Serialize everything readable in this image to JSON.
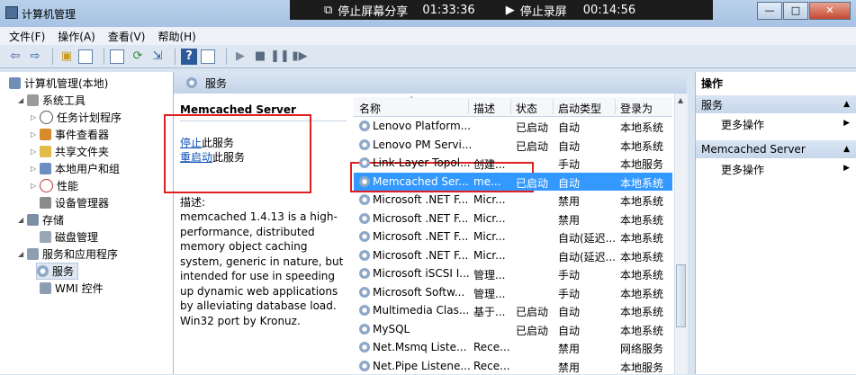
{
  "window": {
    "title": "计算机管理",
    "minimize": "—",
    "maximize": "□",
    "close": "✕"
  },
  "recording": {
    "share_label": "停止屏幕分享",
    "share_time": "01:33:36",
    "record_label": "停止录屏",
    "record_time": "00:14:56"
  },
  "menu": [
    "文件(F)",
    "操作(A)",
    "查看(V)",
    "帮助(H)"
  ],
  "toolbar_icons": [
    "back-icon",
    "forward-icon",
    "up-icon",
    "console-tree-icon",
    "properties-icon",
    "refresh-icon",
    "export-icon",
    "help-icon",
    "show-hide-icon",
    "play-icon",
    "stop-icon",
    "pause-icon",
    "restart-icon"
  ],
  "tree": {
    "root": "计算机管理(本地)",
    "system_tools": "系统工具",
    "task_scheduler": "任务计划程序",
    "event_viewer": "事件查看器",
    "shared_folders": "共享文件夹",
    "local_users": "本地用户和组",
    "performance": "性能",
    "device_manager": "设备管理器",
    "storage": "存储",
    "disk_management": "磁盘管理",
    "services_apps": "服务和应用程序",
    "services": "服务",
    "wmi": "WMI 控件"
  },
  "center": {
    "header": "服务",
    "service_name": "Memcached Server",
    "stop_link": "停止",
    "stop_suffix": "此服务",
    "restart_link": "重启动",
    "restart_suffix": "此服务",
    "desc_label": "描述:",
    "desc_text": "memcached 1.4.13 is a high-performance, distributed memory object caching system, generic in nature, but intended for use in speeding up dynamic web applications by alleviating database load. Win32 port by Kronuz."
  },
  "columns": [
    "名称",
    "描述",
    "状态",
    "启动类型",
    "登录为"
  ],
  "rows": [
    {
      "name": "Lenovo Platform...",
      "desc": "",
      "status": "已启动",
      "startup": "自动",
      "logon": "本地系统"
    },
    {
      "name": "Lenovo PM Servi...",
      "desc": "",
      "status": "已启动",
      "startup": "自动",
      "logon": "本地系统"
    },
    {
      "name": "Link-Layer Topol...",
      "desc": "创建...",
      "status": "",
      "startup": "手动",
      "logon": "本地服务"
    },
    {
      "name": "Memcached Ser...",
      "desc": "me...",
      "status": "已启动",
      "startup": "自动",
      "logon": "本地系统"
    },
    {
      "name": "Microsoft .NET F...",
      "desc": "Micr...",
      "status": "",
      "startup": "禁用",
      "logon": "本地系统"
    },
    {
      "name": "Microsoft .NET F...",
      "desc": "Micr...",
      "status": "",
      "startup": "禁用",
      "logon": "本地系统"
    },
    {
      "name": "Microsoft .NET F...",
      "desc": "Micr...",
      "status": "",
      "startup": "自动(延迟...",
      "logon": "本地系统"
    },
    {
      "name": "Microsoft .NET F...",
      "desc": "Micr...",
      "status": "",
      "startup": "自动(延迟...",
      "logon": "本地系统"
    },
    {
      "name": "Microsoft iSCSI I...",
      "desc": "管理...",
      "status": "",
      "startup": "手动",
      "logon": "本地系统"
    },
    {
      "name": "Microsoft Softw...",
      "desc": "管理...",
      "status": "",
      "startup": "手动",
      "logon": "本地系统"
    },
    {
      "name": "Multimedia Clas...",
      "desc": "基于...",
      "status": "已启动",
      "startup": "自动",
      "logon": "本地系统"
    },
    {
      "name": "MySQL",
      "desc": "",
      "status": "已启动",
      "startup": "自动",
      "logon": "本地系统"
    },
    {
      "name": "Net.Msmq Liste...",
      "desc": "Rece...",
      "status": "",
      "startup": "禁用",
      "logon": "网络服务"
    },
    {
      "name": "Net.Pipe Listene...",
      "desc": "Rece...",
      "status": "",
      "startup": "禁用",
      "logon": "本地服务"
    }
  ],
  "selected_row": 3,
  "actions": {
    "title": "操作",
    "section1": "服务",
    "more1": "更多操作",
    "section2": "Memcached Server",
    "more2": "更多操作"
  },
  "colors": {
    "selection": "#3399ff",
    "highlight_box": "#e02020",
    "link": "#0b4fb3"
  }
}
